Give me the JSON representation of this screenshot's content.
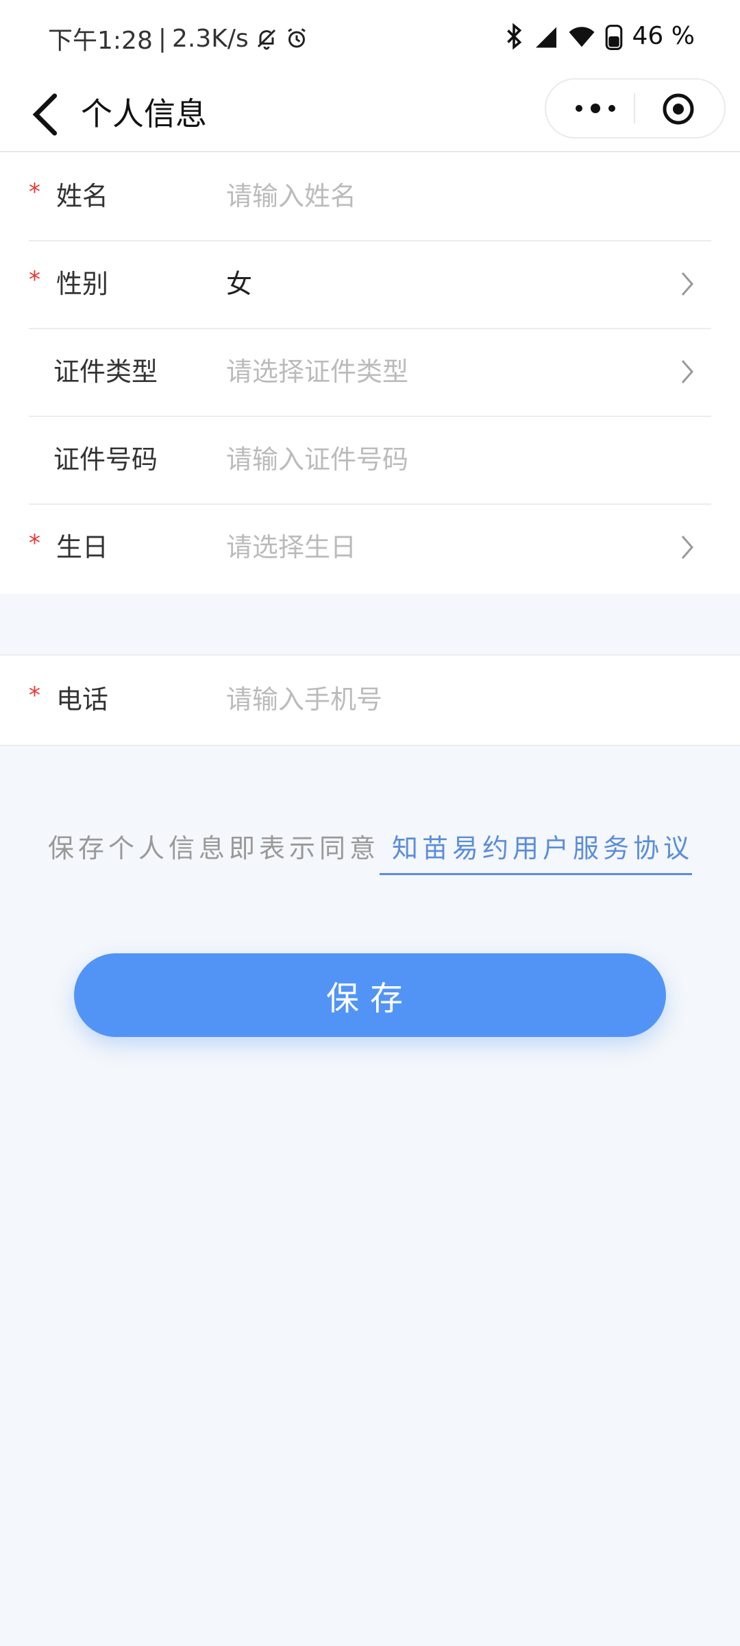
{
  "status_bar": {
    "time": "下午1:28",
    "separator": "|",
    "network_speed": "2.3K/s",
    "battery": "46",
    "battery_unit": "%"
  },
  "nav": {
    "title": "个人信息"
  },
  "form": {
    "rows": [
      {
        "required_mark": "*",
        "label": "姓名",
        "placeholder": "请输入姓名",
        "has_chevron": false
      },
      {
        "required_mark": "*",
        "label": "性别",
        "value": "女",
        "has_chevron": true
      },
      {
        "required_mark": "",
        "label": "证件类型",
        "placeholder": "请选择证件类型",
        "has_chevron": true
      },
      {
        "required_mark": "",
        "label": "证件号码",
        "placeholder": "请输入证件号码",
        "has_chevron": false
      },
      {
        "required_mark": "*",
        "label": "生日",
        "placeholder": "请选择生日",
        "has_chevron": true
      }
    ]
  },
  "phone_row": {
    "required_mark": "*",
    "label": "电话",
    "placeholder": "请输入手机号"
  },
  "agreement": {
    "prefix": "保存个人信息即表示同意",
    "link": "知苗易约用户服务协议"
  },
  "save_button": {
    "label": "保存"
  },
  "colors": {
    "primary": "#5294f6",
    "link": "#5b8dd9",
    "required": "#e53935",
    "background": "#f4f7fb"
  }
}
